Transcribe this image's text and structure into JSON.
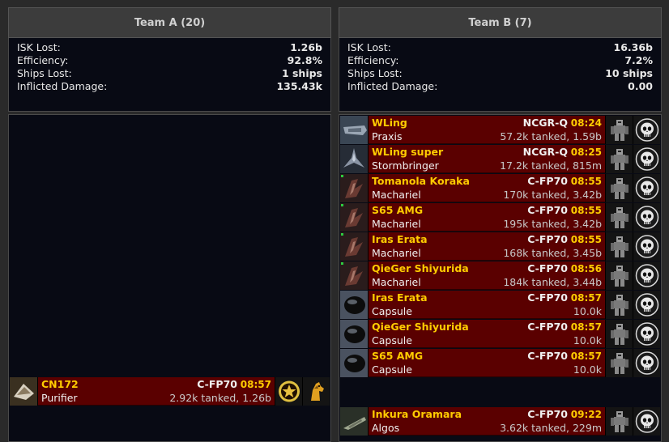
{
  "team_a": {
    "title": "Team A (20)",
    "stats": [
      {
        "label": "ISK Lost:",
        "value": "1.26b"
      },
      {
        "label": "Efficiency:",
        "value": "92.8%"
      },
      {
        "label": "Ships Lost:",
        "value": "1 ships"
      },
      {
        "label": "Inflicted Damage:",
        "value": "135.43k"
      }
    ],
    "kills": [
      {
        "pilot": "CN172",
        "ship": "Purifier",
        "system": "C-FP70",
        "time": "08:57",
        "damage": "2.92k tanked, 1.26b",
        "ship_icon": "bomber-ship-icon",
        "corp_icon": "star-emblem-icon",
        "alliance_icon": "horse-emblem-icon"
      }
    ]
  },
  "team_b": {
    "title": "Team B (7)",
    "stats": [
      {
        "label": "ISK Lost:",
        "value": "16.36b"
      },
      {
        "label": "Efficiency:",
        "value": "7.2%"
      },
      {
        "label": "Ships Lost:",
        "value": "10 ships"
      },
      {
        "label": "Inflicted Damage:",
        "value": "0.00"
      }
    ],
    "kills": [
      {
        "pilot": "WLing",
        "ship": "Praxis",
        "system": "NCGR-Q",
        "time": "08:24",
        "damage": "57.2k tanked, 1.59b",
        "ship_icon": "battleship-icon",
        "corp_icon": "robot-emblem-icon",
        "alliance_icon": "skull-emblem-icon"
      },
      {
        "pilot": "WLing super",
        "ship": "Stormbringer",
        "system": "NCGR-Q",
        "time": "08:25",
        "damage": "17.2k tanked, 815m",
        "ship_icon": "cruiser-icon",
        "corp_icon": "robot-emblem-icon",
        "alliance_icon": "skull-emblem-icon"
      },
      {
        "pilot": "Tomanola Koraka",
        "ship": "Machariel",
        "system": "C-FP70",
        "time": "08:55",
        "damage": "170k tanked, 3.42b",
        "ship_icon": "machariel-icon",
        "corp_icon": "robot-emblem-icon",
        "alliance_icon": "skull-emblem-icon"
      },
      {
        "pilot": "S65 AMG",
        "ship": "Machariel",
        "system": "C-FP70",
        "time": "08:55",
        "damage": "195k tanked, 3.42b",
        "ship_icon": "machariel-icon",
        "corp_icon": "robot-emblem-icon",
        "alliance_icon": "skull-emblem-icon"
      },
      {
        "pilot": "Iras Erata",
        "ship": "Machariel",
        "system": "C-FP70",
        "time": "08:55",
        "damage": "168k tanked, 3.45b",
        "ship_icon": "machariel-icon",
        "corp_icon": "robot-emblem-icon",
        "alliance_icon": "skull-emblem-icon"
      },
      {
        "pilot": "QieGer Shiyurida",
        "ship": "Machariel",
        "system": "C-FP70",
        "time": "08:56",
        "damage": "184k tanked, 3.44b",
        "ship_icon": "machariel-icon",
        "corp_icon": "robot-emblem-icon",
        "alliance_icon": "skull-emblem-icon"
      },
      {
        "pilot": "Iras Erata",
        "ship": "Capsule",
        "system": "C-FP70",
        "time": "08:57",
        "damage": "10.0k",
        "ship_icon": "capsule-icon",
        "corp_icon": "robot-emblem-icon",
        "alliance_icon": "skull-emblem-icon"
      },
      {
        "pilot": "QieGer Shiyurida",
        "ship": "Capsule",
        "system": "C-FP70",
        "time": "08:57",
        "damage": "10.0k",
        "ship_icon": "capsule-icon",
        "corp_icon": "robot-emblem-icon",
        "alliance_icon": "skull-emblem-icon"
      },
      {
        "pilot": "S65 AMG",
        "ship": "Capsule",
        "system": "C-FP70",
        "time": "08:57",
        "damage": "10.0k",
        "ship_icon": "capsule-icon",
        "corp_icon": "robot-emblem-icon",
        "alliance_icon": "skull-emblem-icon"
      },
      {
        "pilot": "Inkura Oramara",
        "ship": "Algos",
        "system": "C-FP70",
        "time": "09:22",
        "damage": "3.62k tanked, 229m",
        "ship_icon": "destroyer-icon",
        "corp_icon": "robot-emblem-icon",
        "alliance_icon": "skull-emblem-icon"
      }
    ]
  },
  "colors": {
    "kill_row": "#5a0000",
    "pilot": "#ffcc00",
    "panel_bg": "#080a14"
  }
}
